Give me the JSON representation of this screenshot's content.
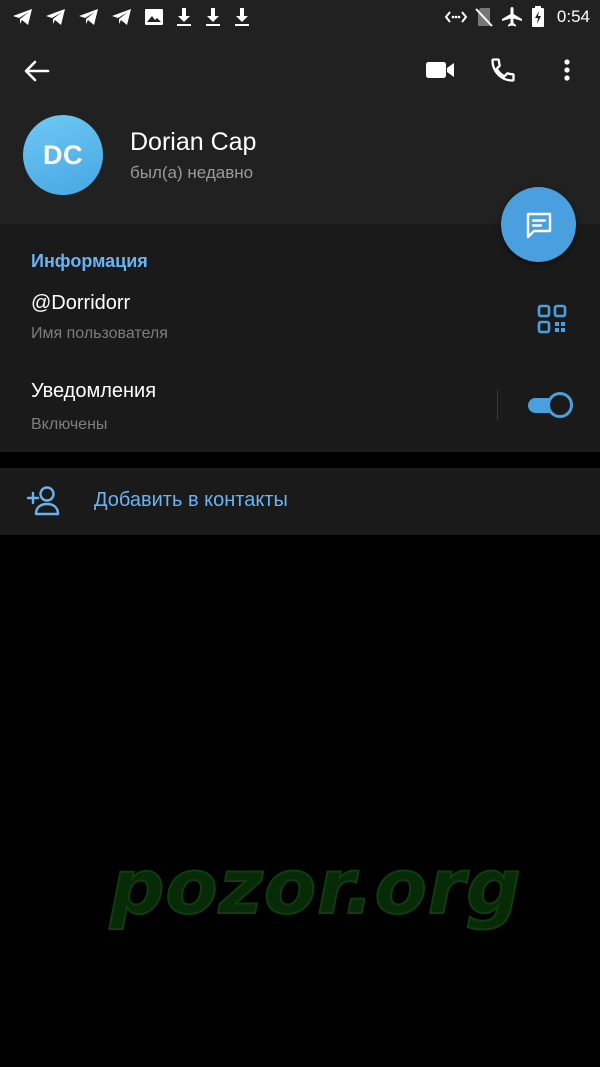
{
  "status_bar": {
    "time": "0:54",
    "left_icons": [
      "telegram-icon",
      "telegram-icon",
      "telegram-icon",
      "telegram-icon",
      "image-icon",
      "download-icon",
      "download-icon",
      "download-icon"
    ],
    "right_icons": [
      "data-saver-icon",
      "no-sim-icon",
      "airplane-icon",
      "battery-charging-icon"
    ]
  },
  "header": {
    "avatar_initials": "DC",
    "name": "Dorian Cap",
    "status": "был(а) недавно"
  },
  "info": {
    "title": "Информация",
    "username": "@Dorridorr",
    "username_label": "Имя пользователя",
    "notifications_title": "Уведомления",
    "notifications_state": "Включены",
    "notifications_enabled": true
  },
  "actions": {
    "add_contact": "Добавить в контакты"
  },
  "watermark": "pozor.org",
  "colors": {
    "accent": "#4a9fdf",
    "link": "#6ab3f3",
    "header_bg": "#212121",
    "section_bg": "#1a1a1a"
  }
}
